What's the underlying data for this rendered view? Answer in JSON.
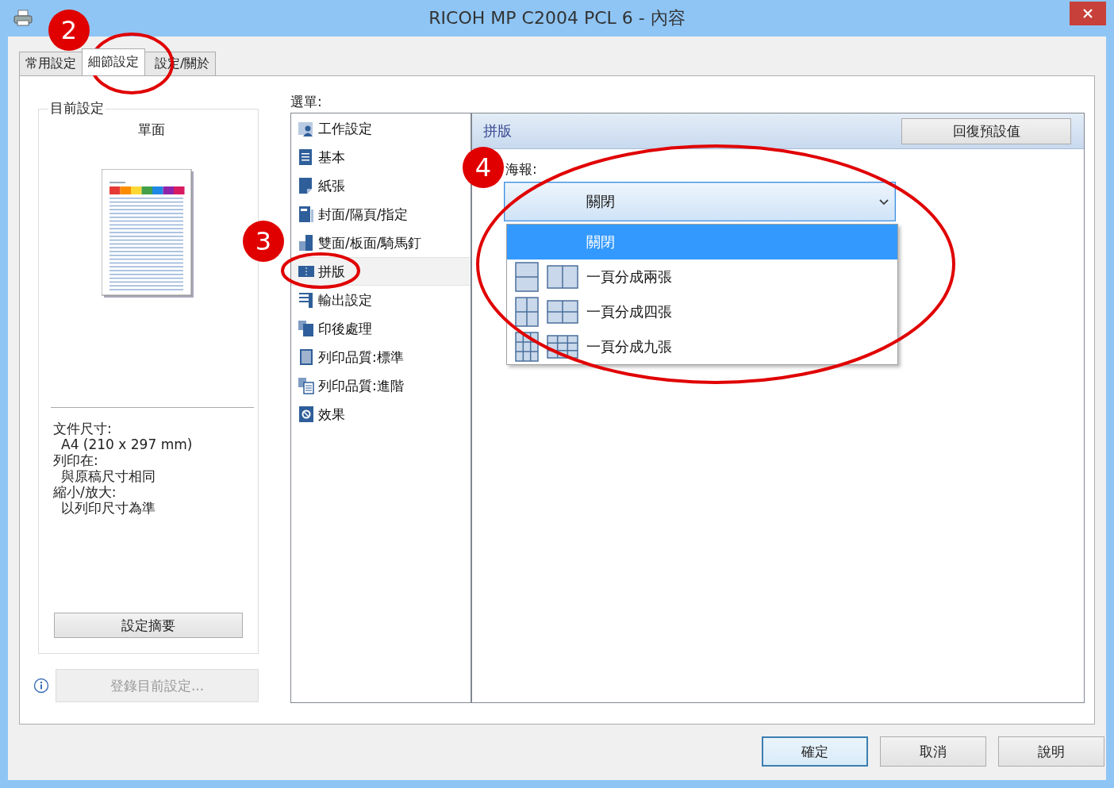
{
  "window": {
    "title": "RICOH MP C2004 PCL 6 - 內容"
  },
  "tabs": [
    {
      "label": "常用設定",
      "selected": false
    },
    {
      "label": "細節設定",
      "selected": true
    },
    {
      "label": "設定/關於",
      "selected": false
    }
  ],
  "current_settings": {
    "title": "目前設定",
    "preview_caption": "單面",
    "info": [
      {
        "label": "文件尺寸:",
        "value": "A4 (210 x 297 mm)"
      },
      {
        "label": "列印在:",
        "value": "與原稿尺寸相同"
      },
      {
        "label": "縮小/放大:",
        "value": "以列印尺寸為準"
      }
    ],
    "summary_button": "設定摘要",
    "register_button": {
      "label": "登錄目前設定...",
      "disabled": true
    }
  },
  "menu": {
    "label": "選單:",
    "items": [
      {
        "label": "工作設定",
        "selected": false
      },
      {
        "label": "基本",
        "selected": false
      },
      {
        "label": "紙張",
        "selected": false
      },
      {
        "label": "封面/隔頁/指定",
        "selected": false
      },
      {
        "label": "雙面/板面/騎馬釘",
        "selected": false
      },
      {
        "label": "拼版",
        "selected": true
      },
      {
        "label": "輸出設定",
        "selected": false
      },
      {
        "label": "印後處理",
        "selected": false
      },
      {
        "label": "列印品質:標準",
        "selected": false
      },
      {
        "label": "列印品質:進階",
        "selected": false
      },
      {
        "label": "效果",
        "selected": false
      }
    ]
  },
  "panel": {
    "title": "拼版",
    "reset_button": "回復預設值",
    "poster": {
      "label": "海報:",
      "value": "關閉",
      "expanded": true,
      "options": [
        {
          "label": "關閉",
          "selected": true,
          "kind": "none"
        },
        {
          "label": "一頁分成兩張",
          "selected": false,
          "kind": "two"
        },
        {
          "label": "一頁分成四張",
          "selected": false,
          "kind": "four"
        },
        {
          "label": "一頁分成九張",
          "selected": false,
          "kind": "nine"
        }
      ]
    }
  },
  "buttons": [
    {
      "label": "確定",
      "default": true
    },
    {
      "label": "取消",
      "default": false
    },
    {
      "label": "說明",
      "default": false
    }
  ],
  "annotations": [
    {
      "label": "2"
    },
    {
      "label": "3"
    },
    {
      "label": "4"
    }
  ]
}
